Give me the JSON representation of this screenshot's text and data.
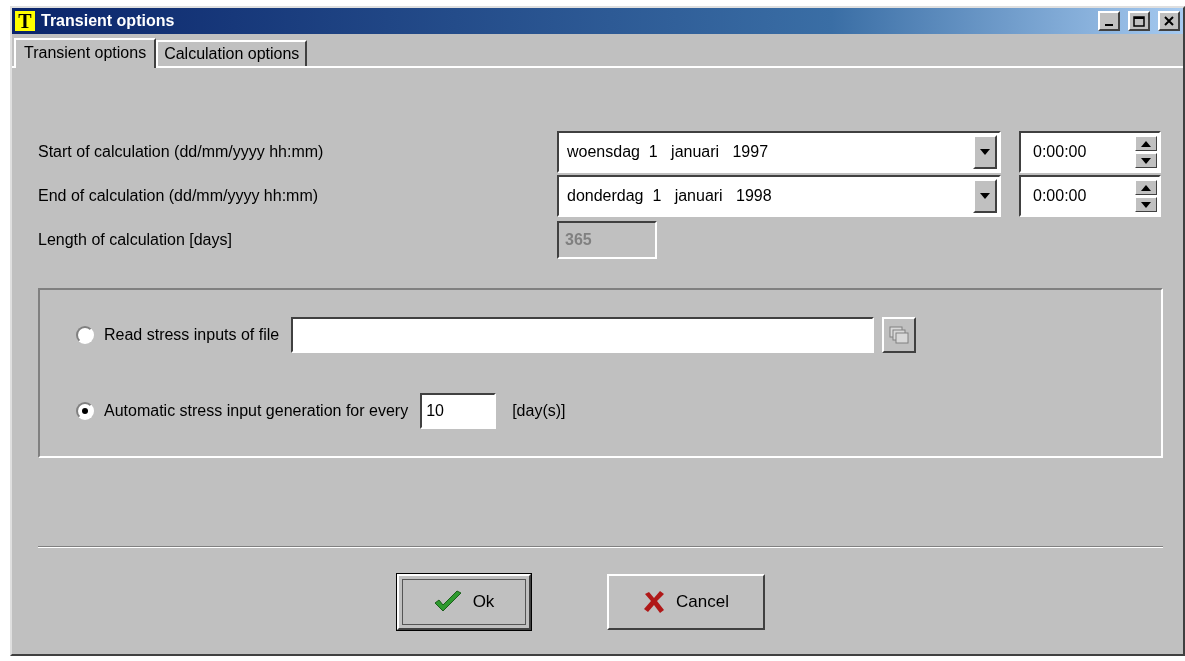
{
  "window": {
    "title": "Transient options",
    "icon_letter": "T"
  },
  "tabs": [
    {
      "label": "Transient options",
      "selected": true
    },
    {
      "label": "Calculation options",
      "selected": false
    }
  ],
  "period": [
    {
      "label": "Start of calculation (dd/mm/yyyy hh:mm)",
      "date": "woensdag  1   januari   1997",
      "time": "0:00:00"
    },
    {
      "label": "End of calculation  (dd/mm/yyyy hh:mm)",
      "date": "donderdag  1   januari   1998",
      "time": "0:00:00"
    }
  ],
  "length": {
    "label": "Length of calculation [days]",
    "value": "365",
    "disabled": true
  },
  "stress_options": [
    {
      "kind": "file",
      "label": "Read stress inputs of file",
      "selected": false
    },
    {
      "kind": "interval",
      "label": "Automatic stress input generation for every",
      "selected": true,
      "value": "10",
      "unit": "[day(s)]"
    }
  ],
  "buttons": [
    {
      "kind": "ok",
      "label": "Ok",
      "focused": true
    },
    {
      "kind": "cancel",
      "label": "Cancel",
      "focused": false
    }
  ]
}
